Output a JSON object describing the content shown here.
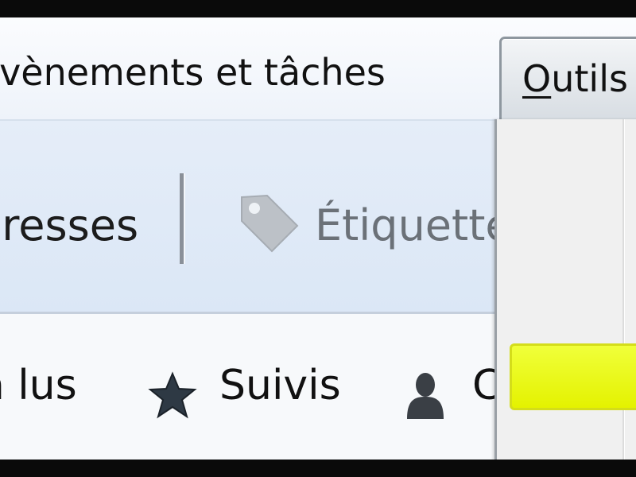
{
  "menubar": {
    "events_tasks": {
      "label": "Évènements et tâches",
      "accel": "É"
    },
    "tools": {
      "label": "Outils",
      "accel": "O"
    }
  },
  "toolbar": {
    "addresses_label": "Adresses",
    "tags_label": "Étiquettes",
    "icons": {
      "tags": "tag-icon"
    }
  },
  "filterbar": {
    "unread_label": "Non lus",
    "watched_label": "Suivis",
    "contacts_label": "Contacts",
    "icons": {
      "watched": "star-icon",
      "contacts": "person-icon"
    }
  },
  "dropdown": {
    "highlight_color": "#f0ff3a"
  },
  "colors": {
    "menubar_bg": "#eef3fa",
    "toolbar_bg": "#dbe7f6",
    "filterbar_bg": "#f7f9fb",
    "highlight": "#f0ff3a"
  }
}
